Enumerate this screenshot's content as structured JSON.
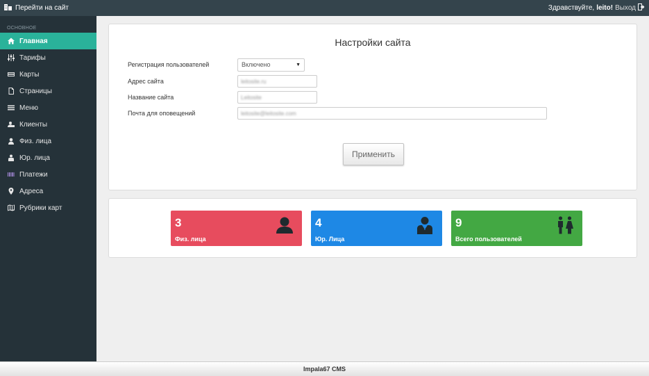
{
  "topbar": {
    "goto_site": "Перейти на сайт",
    "greeting": "Здравствуйте,",
    "username": "leito!",
    "logout": "Выход"
  },
  "sidebar": {
    "section": "ОСНОВНОЕ",
    "items": [
      {
        "label": "Главная",
        "icon": "home-icon",
        "active": true
      },
      {
        "label": "Тарифы",
        "icon": "sliders-icon"
      },
      {
        "label": "Карты",
        "icon": "credit-card-icon"
      },
      {
        "label": "Страницы",
        "icon": "page-icon"
      },
      {
        "label": "Меню",
        "icon": "menu-icon"
      },
      {
        "label": "Клиенты",
        "icon": "clients-icon"
      },
      {
        "label": "Физ. лица",
        "icon": "person-icon"
      },
      {
        "label": "Юр. лица",
        "icon": "suit-icon"
      },
      {
        "label": "Платежи",
        "icon": "barcode-icon"
      },
      {
        "label": "Адреса",
        "icon": "map-marker-icon"
      },
      {
        "label": "Рубрики карт",
        "icon": "map-icon"
      }
    ]
  },
  "settings": {
    "title": "Настройки сайта",
    "fields": {
      "registration_label": "Регистрация пользователей",
      "registration_value": "Включено",
      "address_label": "Адрес сайта",
      "address_value": "leitosite.ru",
      "name_label": "Название сайта",
      "name_value": "Leitosite",
      "email_label": "Почта для оповещений",
      "email_value": "leitosite@leitosite.com"
    },
    "apply": "Применить"
  },
  "stats": [
    {
      "count": "3",
      "label": "Физ. лица",
      "color": "#e74c5e",
      "icon": "person-icon"
    },
    {
      "count": "4",
      "label": "Юр. Лица",
      "color": "#1e88e5",
      "icon": "suit-icon"
    },
    {
      "count": "9",
      "label": "Всего пользователей",
      "color": "#43a843",
      "icon": "users-icon"
    }
  ],
  "footer": "Impala67 CMS",
  "colors": {
    "topbar": "#34444c",
    "sidebar": "#253239",
    "active": "#2ab29a"
  }
}
